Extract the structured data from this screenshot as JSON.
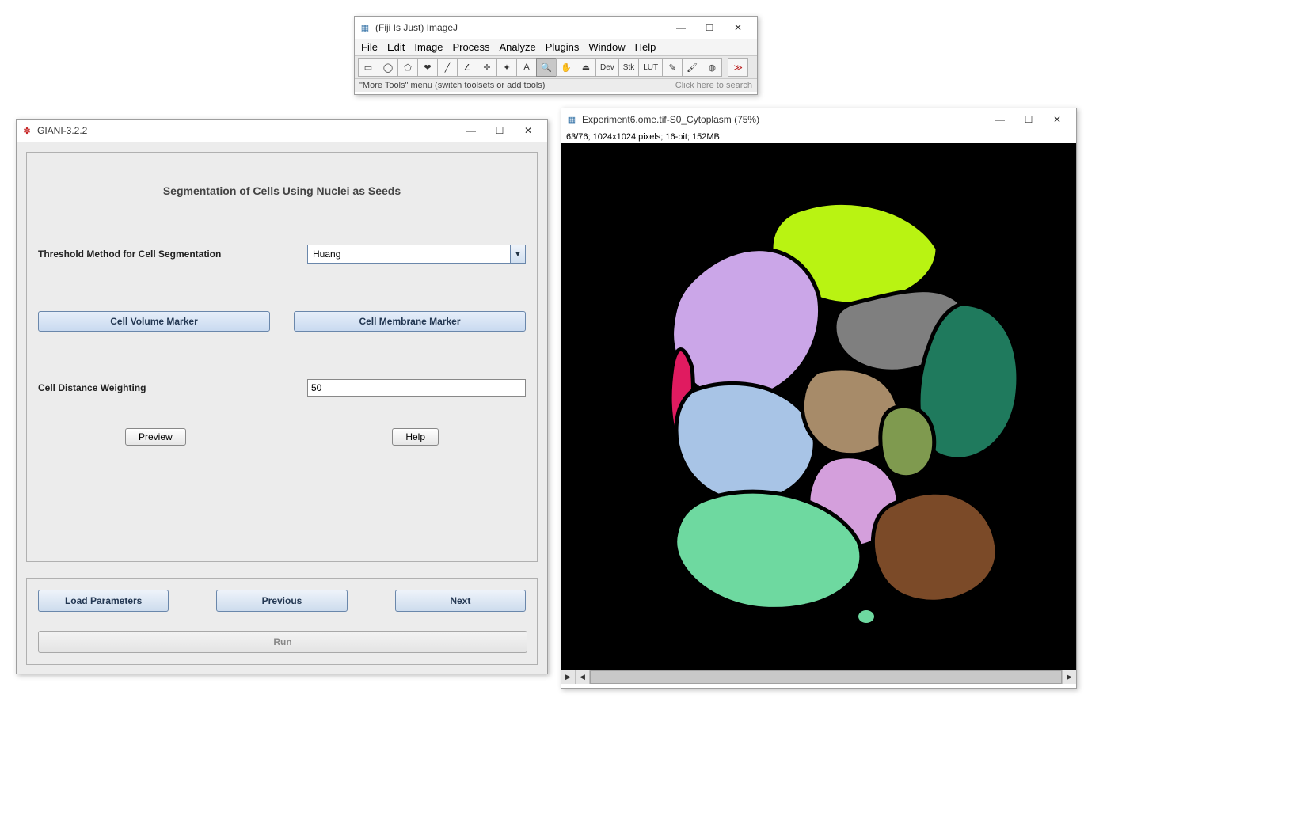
{
  "imagej": {
    "title": "(Fiji Is Just) ImageJ",
    "menu": [
      "File",
      "Edit",
      "Image",
      "Process",
      "Analyze",
      "Plugins",
      "Window",
      "Help"
    ],
    "tools": [
      {
        "name": "rectangle-tool",
        "glyph": "▭"
      },
      {
        "name": "oval-tool",
        "glyph": "◯"
      },
      {
        "name": "polygon-tool",
        "glyph": "⬠"
      },
      {
        "name": "freehand-tool",
        "glyph": "❤"
      },
      {
        "name": "line-tool",
        "glyph": "╱"
      },
      {
        "name": "angle-tool",
        "glyph": "∠"
      },
      {
        "name": "point-tool",
        "glyph": "✛"
      },
      {
        "name": "wand-tool",
        "glyph": "✦"
      },
      {
        "name": "text-tool",
        "glyph": "A"
      },
      {
        "name": "zoom-tool",
        "glyph": "🔍",
        "selected": true
      },
      {
        "name": "hand-tool",
        "glyph": "✋"
      },
      {
        "name": "color-picker-tool",
        "glyph": "⏏"
      },
      {
        "name": "dev-tool",
        "glyph": "Dev",
        "text": true
      },
      {
        "name": "stk-tool",
        "glyph": "Stk",
        "text": true
      },
      {
        "name": "lut-tool",
        "glyph": "LUT",
        "text": true
      },
      {
        "name": "pencil-tool",
        "glyph": "✎"
      },
      {
        "name": "brush-tool",
        "glyph": "🖌"
      },
      {
        "name": "flood-tool",
        "glyph": "◍"
      },
      {
        "name": "more-tools",
        "glyph": "≫"
      }
    ],
    "status_hint": "\"More Tools\" menu (switch toolsets or add tools)",
    "search_hint": "Click here to search"
  },
  "giani": {
    "title": "GIANI-3.2.2",
    "heading": "Segmentation of Cells Using Nuclei as Seeds",
    "threshold_label": "Threshold Method for Cell Segmentation",
    "threshold_value": "Huang",
    "volume_btn": "Cell Volume Marker",
    "membrane_btn": "Cell Membrane Marker",
    "distance_label": "Cell Distance Weighting",
    "distance_value": "50",
    "preview_btn": "Preview",
    "help_btn": "Help",
    "load_btn": "Load Parameters",
    "prev_btn": "Previous",
    "next_btn": "Next",
    "run_btn": "Run"
  },
  "image_win": {
    "title": "Experiment6.ome.tif-S0_Cytoplasm (75%)",
    "meta": "63/76; 1024x1024 pixels; 16-bit; 152MB"
  },
  "chart_data": {
    "type": "segmentation",
    "description": "Label map of segmented cells on black background",
    "cells": [
      {
        "id": 1,
        "color": "#b9f312",
        "hint": "top lime"
      },
      {
        "id": 2,
        "color": "#cba6e8",
        "hint": "upper-left lavender"
      },
      {
        "id": 3,
        "color": "#7f7f7f",
        "hint": "upper-right gray"
      },
      {
        "id": 4,
        "color": "#1f7a5d",
        "hint": "right dark-teal"
      },
      {
        "id": 5,
        "color": "#e01b60",
        "hint": "left magenta sliver"
      },
      {
        "id": 6,
        "color": "#a8c4e6",
        "hint": "center-left light-blue"
      },
      {
        "id": 7,
        "color": "#a78b69",
        "hint": "center tan"
      },
      {
        "id": 8,
        "color": "#7f9a4f",
        "hint": "center olive"
      },
      {
        "id": 9,
        "color": "#d49fdc",
        "hint": "lower-center pink"
      },
      {
        "id": 10,
        "color": "#6ed9a0",
        "hint": "bottom mint"
      },
      {
        "id": 11,
        "color": "#7b4a28",
        "hint": "bottom-right brown"
      }
    ]
  }
}
